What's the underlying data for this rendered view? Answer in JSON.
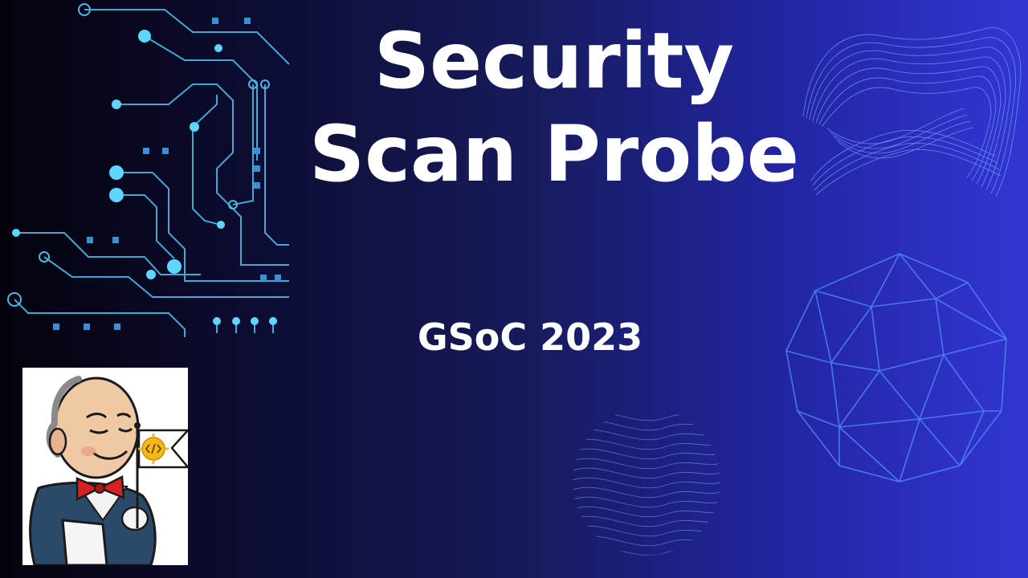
{
  "slide": {
    "title_line1": "Security",
    "title_line2": "Scan Probe",
    "subtitle": "GSoC 2023"
  },
  "colors": {
    "background_left": "#03030c",
    "background_right": "#3236d2",
    "circuit": "#5fd6ff",
    "title_text": "#ffffff",
    "mesh": "#5a8dff"
  },
  "icons": {
    "circuit": "circuit-board-graphic",
    "ribbon": "wireframe-ribbon",
    "sphere": "wireframe-geodesic-sphere",
    "wave_disc": "wave-lines-disc",
    "logo": "jenkins-butler-with-gsoc-flag"
  }
}
